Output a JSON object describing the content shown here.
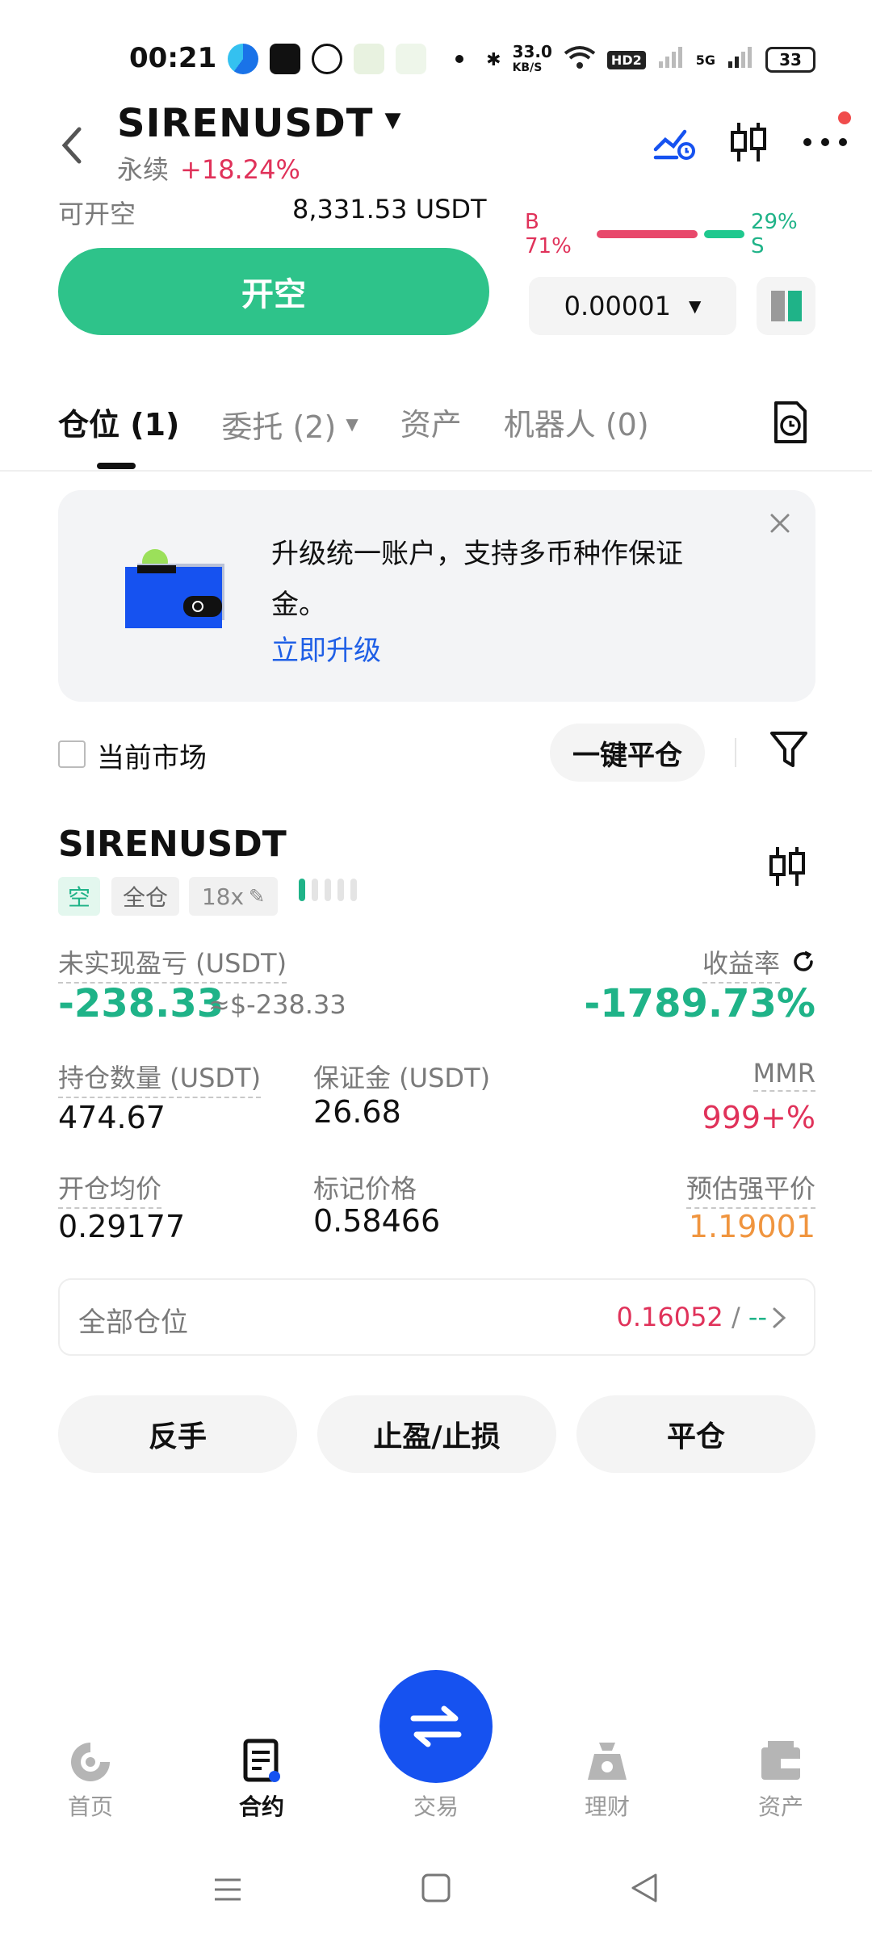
{
  "status_bar": {
    "time": "00:21",
    "net_speed_top": "33.0",
    "net_speed_unit": "KB/S",
    "hd_badge": "HD2",
    "net_type": "5G",
    "battery": "33"
  },
  "header": {
    "symbol": "SIRENUSDT",
    "contract_type": "永续",
    "change_pct": "+18.24%"
  },
  "order_panel": {
    "avail_label": "可开空",
    "avail_value": "8,331.53 USDT",
    "buy_ratio": "B 71%",
    "sell_ratio": "29% S",
    "buy_ratio_value": 0.71,
    "open_short_label": "开空",
    "precision_value": "0.00001"
  },
  "tabs": [
    {
      "label": "仓位 (1)"
    },
    {
      "label": "委托 (2)"
    },
    {
      "label": "资产"
    },
    {
      "label": "机器人 (0)"
    }
  ],
  "banner": {
    "text": "升级统一账户，支持多币种作保证金。",
    "link": "立即升级"
  },
  "filter_row": {
    "current_market_label": "当前市场",
    "close_all_label": "一键平仓"
  },
  "position": {
    "symbol": "SIRENUSDT",
    "side_tag": "空",
    "margin_tag": "全仓",
    "leverage_tag": "18x",
    "pnl_label": "未实现盈亏 (USDT)",
    "pnl_value": "-238.33",
    "pnl_usd": "≈$-238.33",
    "roe_label": "收益率",
    "roe_value": "-1789.73%",
    "size_label": "持仓数量 (USDT)",
    "size_value": "474.67",
    "margin_label": "保证金 (USDT)",
    "margin_value": "26.68",
    "mmr_label": "MMR",
    "mmr_value": "999+%",
    "entry_label": "开仓均价",
    "entry_value": "0.29177",
    "mark_label": "标记价格",
    "mark_value": "0.58466",
    "liq_label": "预估强平价",
    "liq_value": "1.19001"
  },
  "all_positions": {
    "label": "全部仓位",
    "value_red": "0.16052",
    "slash": " / ",
    "value_green": "--"
  },
  "actions": {
    "reverse": "反手",
    "tpsl": "止盈/止损",
    "close": "平仓"
  },
  "bottom_nav": {
    "home": "首页",
    "contract": "合约",
    "trade": "交易",
    "finance": "理财",
    "assets": "资产"
  },
  "colors": {
    "green": "#2ec38a",
    "red": "#e0325a",
    "blue": "#1652f0",
    "orange": "#f0953f"
  }
}
